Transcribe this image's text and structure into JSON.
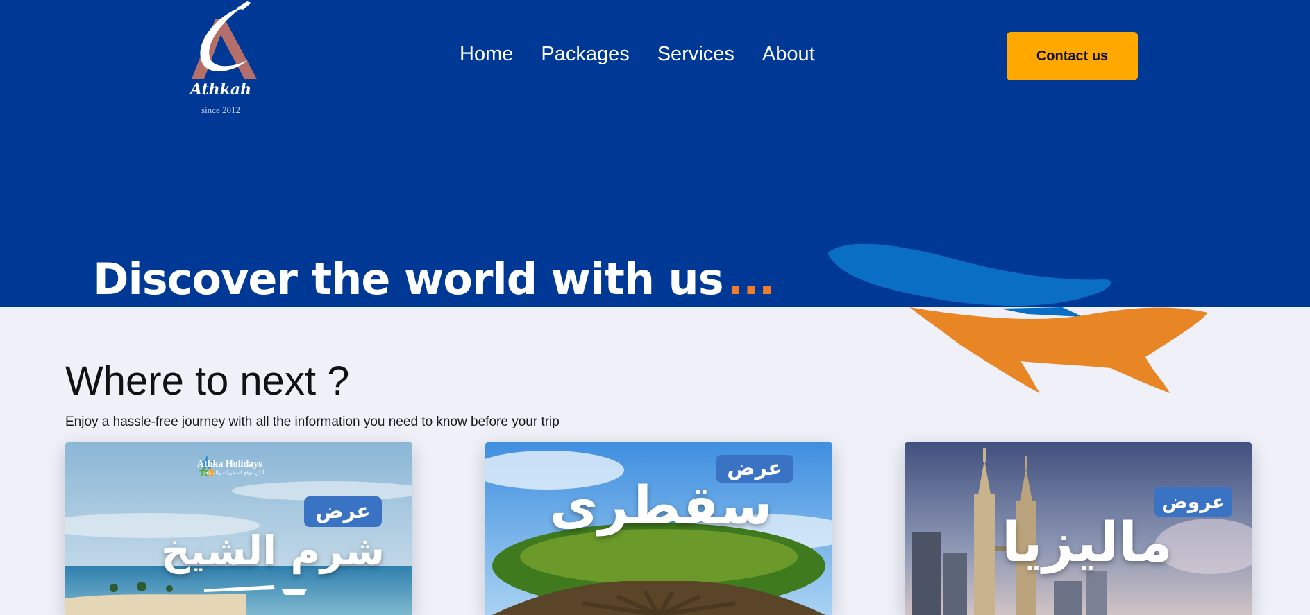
{
  "header": {
    "logo": {
      "name": "Athkah",
      "since": "since 2012"
    },
    "nav": [
      "Home",
      "Packages",
      "Services",
      "About"
    ],
    "contact_label": "Contact us"
  },
  "hero": {
    "title": "Discover the world with us",
    "dots": "..."
  },
  "colors": {
    "hero_bg": "#003896",
    "accent": "#ffa800",
    "plane_blue": "#0a6fc4",
    "plane_orange": "#e88524",
    "page_bg": "#f0f1f8"
  },
  "section": {
    "title": "Where to next ?",
    "subtitle": "Enjoy a hassle-free journey with all the information you need to know before your trip"
  },
  "cards": [
    {
      "badge": "عرض",
      "headline": "شرم الشيخ",
      "brand": "Athka Holidays",
      "brand_sub": "أتكن موقع السفريات والسياحة"
    },
    {
      "badge": "عرض",
      "headline": "سقطرى"
    },
    {
      "badge": "عروض",
      "headline": "ماليزيا"
    }
  ]
}
